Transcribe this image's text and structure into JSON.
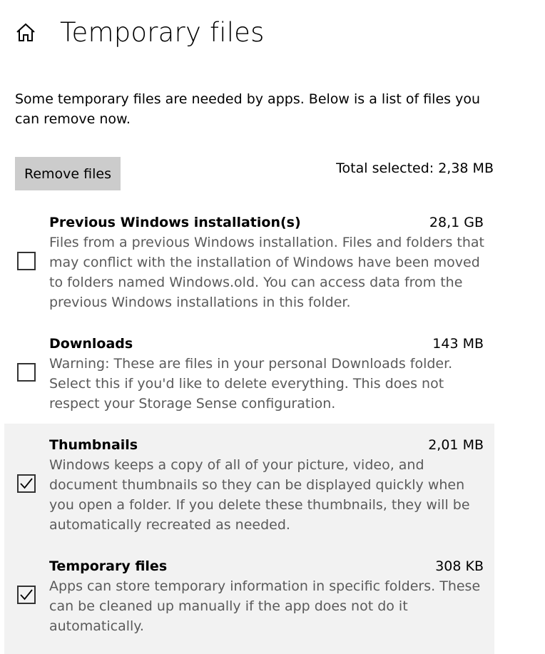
{
  "header": {
    "title": "Temporary files",
    "home_icon": "home-icon"
  },
  "intro": "Some temporary files are needed by apps. Below is a list of files you can remove now.",
  "actions": {
    "remove_label": "Remove files",
    "total_selected": "Total selected: 2,38 MB"
  },
  "items": [
    {
      "name": "Previous Windows installation(s)",
      "size": "28,1 GB",
      "checked": false,
      "description": "Files from a previous Windows installation.  Files and folders that may conflict with the installation of Windows have been moved to folders named Windows.old.  You can access data from the previous Windows installations in this folder."
    },
    {
      "name": "Downloads",
      "size": "143 MB",
      "checked": false,
      "description": "Warning: These are files in your personal Downloads folder. Select this if you'd like to delete everything. This does not respect your Storage Sense configuration."
    },
    {
      "name": "Thumbnails",
      "size": "2,01 MB",
      "checked": true,
      "description": "Windows keeps a copy of all of your picture, video, and document thumbnails so they can be displayed quickly when you open a folder. If you delete these thumbnails, they will be automatically recreated as needed."
    },
    {
      "name": "Temporary files",
      "size": "308 KB",
      "checked": true,
      "description": "Apps can store temporary information in specific folders. These can be cleaned up manually if the app does not do it automatically."
    }
  ],
  "colors": {
    "selected_row_bg": "#f2f2f2",
    "button_bg": "#cccccc",
    "description_text": "#5a5a5a"
  }
}
